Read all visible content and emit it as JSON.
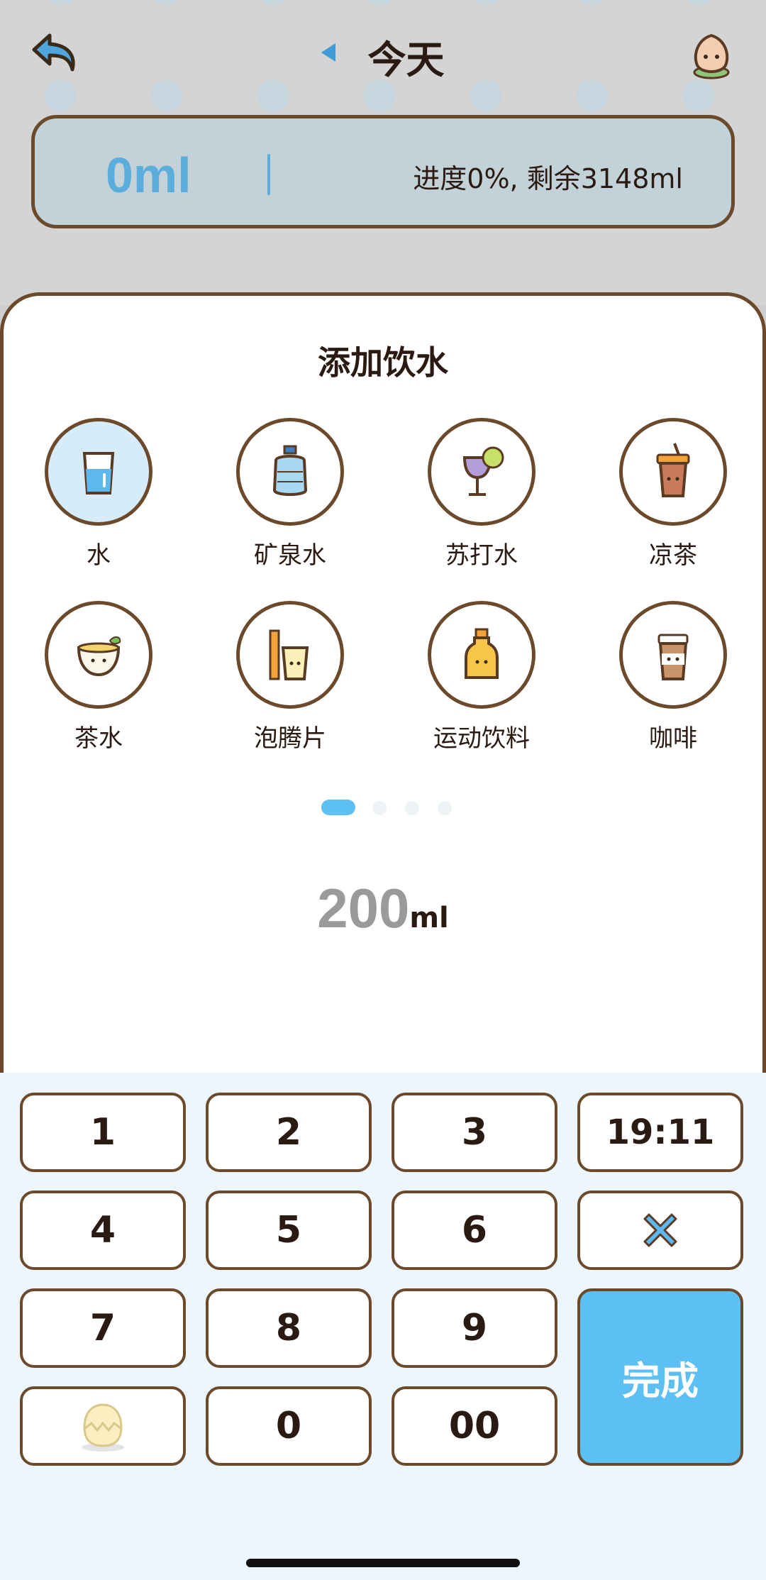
{
  "header": {
    "title": "今天"
  },
  "progress": {
    "total": "0ml",
    "status": "进度0%, 剩余3148ml"
  },
  "sheet": {
    "title": "添加饮水",
    "drinks": [
      {
        "label": "水",
        "icon": "water-glass-icon",
        "selected": true
      },
      {
        "label": "矿泉水",
        "icon": "mineral-water-bottle-icon",
        "selected": false
      },
      {
        "label": "苏打水",
        "icon": "soda-cocktail-icon",
        "selected": false
      },
      {
        "label": "凉茶",
        "icon": "herbal-tea-cup-icon",
        "selected": false
      },
      {
        "label": "茶水",
        "icon": "tea-cup-icon",
        "selected": false
      },
      {
        "label": "泡腾片",
        "icon": "effervescent-tablet-icon",
        "selected": false
      },
      {
        "label": "运动饮料",
        "icon": "sports-drink-bottle-icon",
        "selected": false
      },
      {
        "label": "咖啡",
        "icon": "coffee-cup-icon",
        "selected": false
      }
    ],
    "pager": {
      "total_pages": 4,
      "current_page": 1
    },
    "amount": {
      "value": "200",
      "unit": "ml"
    }
  },
  "keypad": {
    "keys": [
      "1",
      "2",
      "3",
      "19:11",
      "4",
      "5",
      "6",
      "7",
      "8",
      "9",
      "0",
      "00"
    ],
    "done_label": "完成",
    "delete_icon": "close-x-icon",
    "mascot_icon": "egg-mascot-icon"
  },
  "colors": {
    "accent": "#5cc0f5",
    "border": "#6b4a2b",
    "text": "#2a1a12",
    "amount_gray": "#9a9a9a"
  }
}
